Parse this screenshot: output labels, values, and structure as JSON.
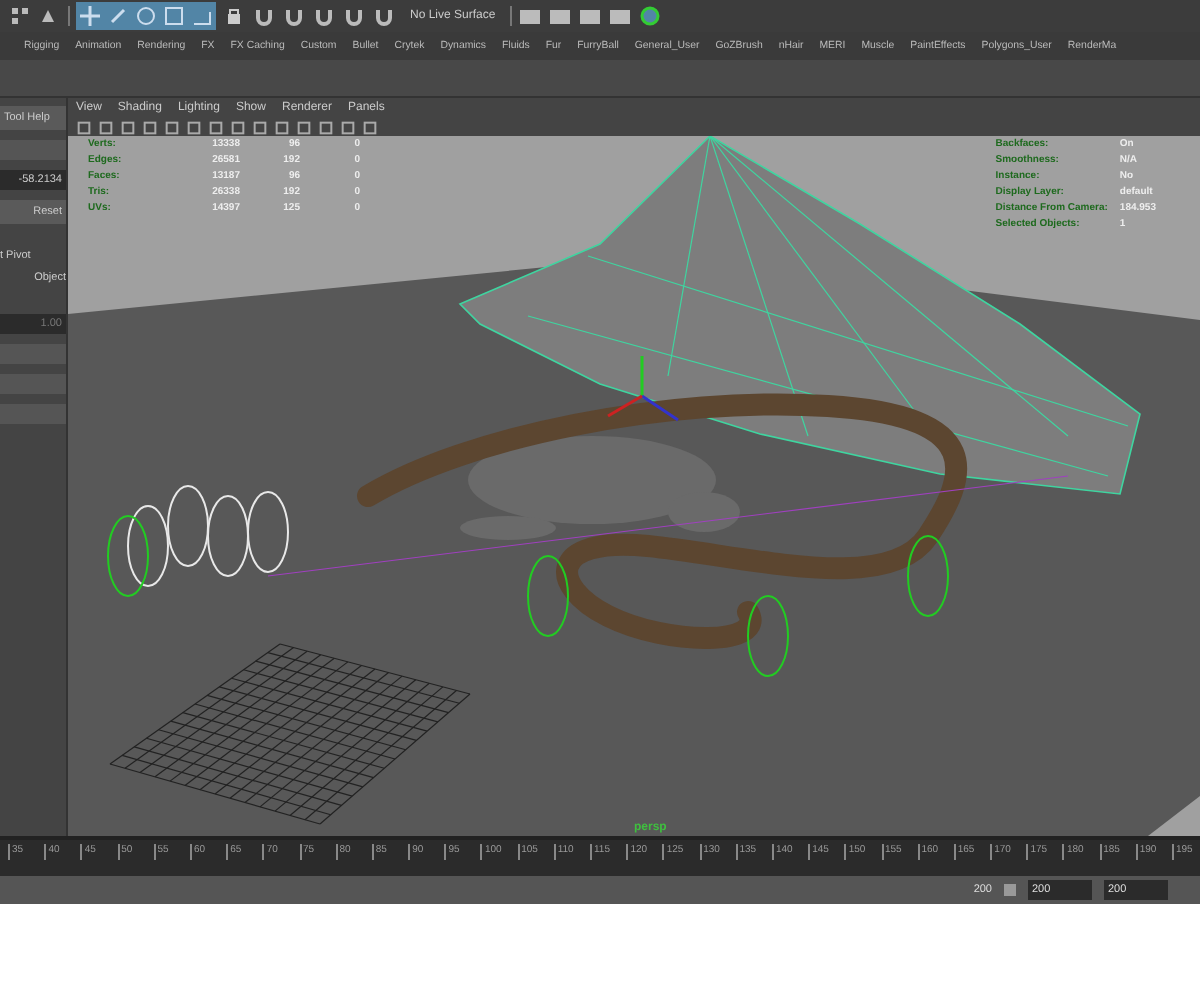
{
  "toolbar": {
    "live_surface": "No Live Surface"
  },
  "shelf_tabs": [
    "Rigging",
    "Animation",
    "Rendering",
    "FX",
    "FX Caching",
    "Custom",
    "Bullet",
    "Crytek",
    "Dynamics",
    "Fluids",
    "Fur",
    "FurryBall",
    "General_User",
    "GoZBrush",
    "nHair",
    "MERI",
    "Muscle",
    "PaintEffects",
    "Polygons_User",
    "RenderMa"
  ],
  "left_panel": {
    "tool_help": "Tool Help",
    "value": "-58.2134",
    "reset": "Reset",
    "pivot": "t Pivot",
    "object": "Object",
    "scale": "1.00"
  },
  "viewport_menu": [
    "View",
    "Shading",
    "Lighting",
    "Show",
    "Renderer",
    "Panels"
  ],
  "hud_stats": [
    {
      "label": "Verts:",
      "values": [
        "13338",
        "96",
        "0"
      ]
    },
    {
      "label": "Edges:",
      "values": [
        "26581",
        "192",
        "0"
      ]
    },
    {
      "label": "Faces:",
      "values": [
        "13187",
        "96",
        "0"
      ]
    },
    {
      "label": "Tris:",
      "values": [
        "26338",
        "192",
        "0"
      ]
    },
    {
      "label": "UVs:",
      "values": [
        "14397",
        "125",
        "0"
      ]
    }
  ],
  "hud_info": [
    {
      "label": "Backfaces:",
      "value": "On"
    },
    {
      "label": "Smoothness:",
      "value": "N/A"
    },
    {
      "label": "Instance:",
      "value": "No"
    },
    {
      "label": "Display Layer:",
      "value": "default"
    },
    {
      "label": "Distance From Camera:",
      "value": "184.953"
    },
    {
      "label": "Selected Objects:",
      "value": "1"
    }
  ],
  "camera_label": "persp",
  "timeline": {
    "ticks": [
      "35",
      "40",
      "45",
      "50",
      "55",
      "60",
      "65",
      "70",
      "75",
      "80",
      "85",
      "90",
      "95",
      "100",
      "105",
      "110",
      "115",
      "120",
      "125",
      "130",
      "135",
      "140",
      "145",
      "150",
      "155",
      "160",
      "165",
      "170",
      "175",
      "180",
      "185",
      "190",
      "195"
    ]
  },
  "range": {
    "end": "200",
    "start_field": "200",
    "end_field": "200"
  }
}
